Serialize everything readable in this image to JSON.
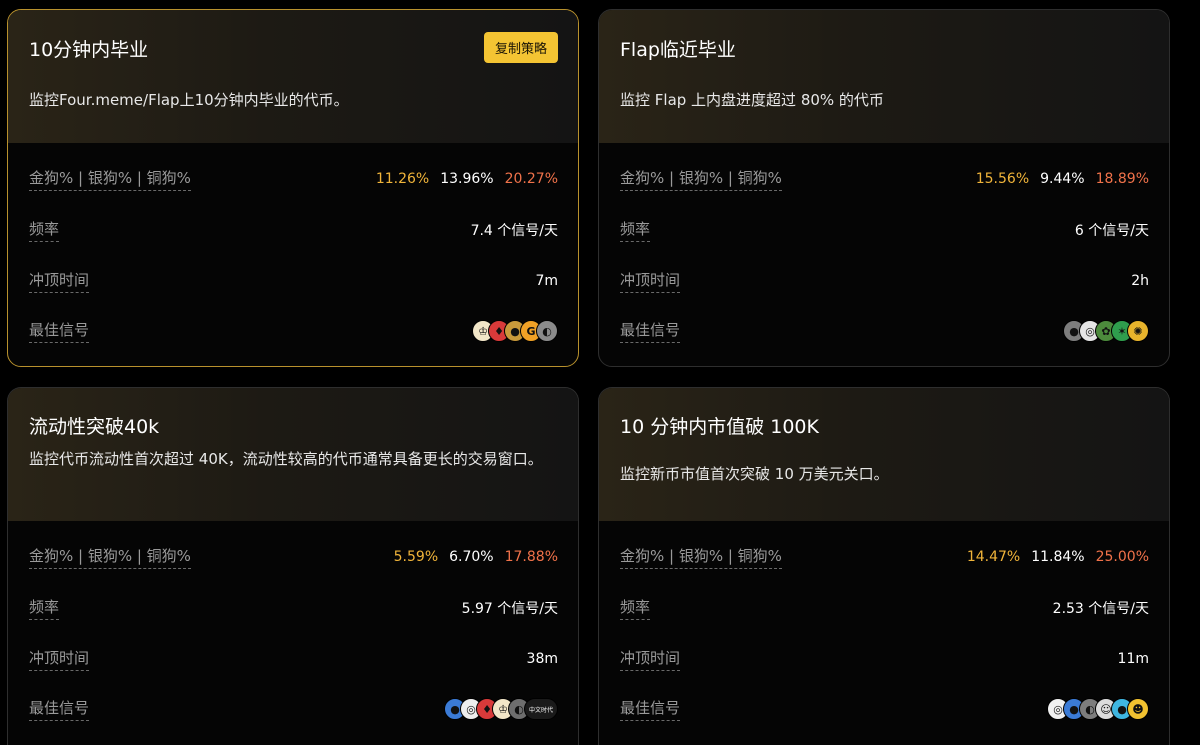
{
  "copy_label": "复制策略",
  "cards": [
    {
      "title": "10分钟内毕业",
      "description": "监控Four.meme/Flap上10分钟内毕业的代币。",
      "metrics_label": "金狗% | 银狗% | 铜狗%",
      "gold_pct": "11.26%",
      "silver_pct": "13.96%",
      "bronze_pct": "20.27%",
      "frequency_label": "频率",
      "frequency": "7.4 个信号/天",
      "peak_time_label": "冲顶时间",
      "peak_time": "7m",
      "best_signal_label": "最佳信号",
      "avatars": [
        {
          "icon": "crown-token-icon",
          "color": "#f2e6c8",
          "glyph": "♔"
        },
        {
          "icon": "red-card-token-icon",
          "color": "#d83a3a",
          "glyph": "♦"
        },
        {
          "icon": "gold-dog-token-icon",
          "color": "#c99a3b",
          "glyph": "●"
        },
        {
          "icon": "g-token-icon",
          "color": "#f0a126",
          "glyph": "G"
        },
        {
          "icon": "mono-token-icon",
          "color": "#8b8b8b",
          "glyph": "◐"
        }
      ]
    },
    {
      "title": "Flap临近毕业",
      "description": "监控 Flap 上内盘进度超过 80% 的代币",
      "metrics_label": "金狗% | 银狗% | 铜狗%",
      "gold_pct": "15.56%",
      "silver_pct": "9.44%",
      "bronze_pct": "18.89%",
      "frequency_label": "频率",
      "frequency": "6 个信号/天",
      "peak_time_label": "冲顶时间",
      "peak_time": "2h",
      "best_signal_label": "最佳信号",
      "avatars": [
        {
          "icon": "gray-token-icon",
          "color": "#7d7d7d",
          "glyph": "●"
        },
        {
          "icon": "white-token-icon",
          "color": "#e6e6e6",
          "glyph": "◎"
        },
        {
          "icon": "green-token-icon",
          "color": "#4c8a3c",
          "glyph": "✿"
        },
        {
          "icon": "leaf-token-icon",
          "color": "#2f9d4d",
          "glyph": "✶"
        },
        {
          "icon": "sun-token-icon",
          "color": "#e8b42c",
          "glyph": "✺"
        }
      ]
    },
    {
      "title": "流动性突破40k",
      "description": "监控代币流动性首次超过 40K，流动性较高的代币通常具备更长的交易窗口。",
      "metrics_label": "金狗% | 银狗% | 铜狗%",
      "gold_pct": "5.59%",
      "silver_pct": "6.70%",
      "bronze_pct": "17.88%",
      "frequency_label": "频率",
      "frequency": "5.97 个信号/天",
      "peak_time_label": "冲顶时间",
      "peak_time": "38m",
      "best_signal_label": "最佳信号",
      "avatars": [
        {
          "icon": "blue-token-icon",
          "color": "#3b7bd6",
          "glyph": "●"
        },
        {
          "icon": "white-token-icon",
          "color": "#eeeeee",
          "glyph": "◎"
        },
        {
          "icon": "red-card-token-icon",
          "color": "#d83a3a",
          "glyph": "♦"
        },
        {
          "icon": "crown-token-icon",
          "color": "#f2e6c8",
          "glyph": "♔"
        },
        {
          "icon": "mono-token-icon",
          "color": "#6e6e6e",
          "glyph": "◐"
        },
        {
          "icon": "chinese-era-token-icon",
          "color": "#1a1a1a",
          "glyph": "中文时代",
          "wide": true
        }
      ]
    },
    {
      "title": "10 分钟内市值破 100K",
      "description": "监控新币市值首次突破 10 万美元关口。",
      "metrics_label": "金狗% | 银狗% | 铜狗%",
      "gold_pct": "14.47%",
      "silver_pct": "11.84%",
      "bronze_pct": "25.00%",
      "frequency_label": "频率",
      "frequency": "2.53 个信号/天",
      "peak_time_label": "冲顶时间",
      "peak_time": "11m",
      "best_signal_label": "最佳信号",
      "avatars": [
        {
          "icon": "white-token-icon",
          "color": "#f0f0f0",
          "glyph": "◎"
        },
        {
          "icon": "blue-token-icon",
          "color": "#3b7bd6",
          "glyph": "●"
        },
        {
          "icon": "mono-token-icon",
          "color": "#7d7d7d",
          "glyph": "◐"
        },
        {
          "icon": "portrait-token-icon",
          "color": "#dcdcdc",
          "glyph": "☺"
        },
        {
          "icon": "cyan-token-icon",
          "color": "#3fb6e0",
          "glyph": "●"
        },
        {
          "icon": "yellow-face-token-icon",
          "color": "#f2c230",
          "glyph": "☻"
        }
      ]
    }
  ]
}
